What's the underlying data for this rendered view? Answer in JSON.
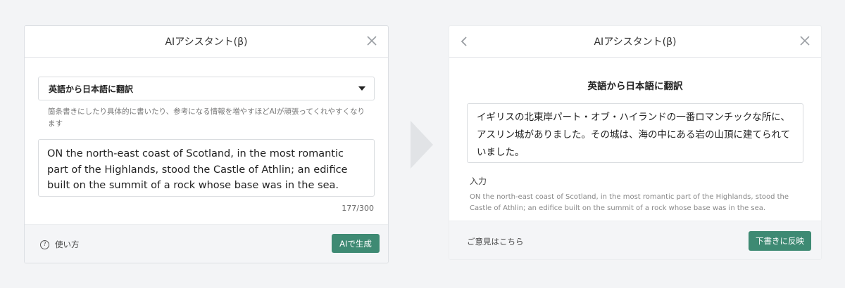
{
  "left_panel": {
    "title": "AIアシスタント(β)",
    "select_value": "英語から日本語に翻訳",
    "hint": "箇条書きにしたり具体的に書いたり、参考になる情報を増やすほどAIが頑張ってくれやすくなります",
    "input_text": "ON the north-east coast of Scotland, in the most romantic part of the Highlands, stood the Castle of Athlin; an edifice built on the summit of a rock whose base was in the sea.",
    "counter": "177/300",
    "help_label": "使い方",
    "help_icon": "?",
    "generate_button": "AIで生成"
  },
  "right_panel": {
    "title": "AIアシスタント(β)",
    "mode_title": "英語から日本語に翻訳",
    "result_text": "イギリスの北東岸パート・オブ・ハイランドの一番ロマンチックな所に、アスリン城がありました。その城は、海の中にある岩の山頂に建てられていました。",
    "input_label": "入力",
    "input_text": "ON the north-east coast of Scotland, in the most romantic part of the Highlands, stood the Castle of Athlin; an edifice built on the summit of a rock whose base was in the sea.",
    "feedback_link": "ご意見はこちら",
    "draft_button": "下書きに反映"
  },
  "colors": {
    "accent": "#3e8a73",
    "background": "#f3f4f6",
    "footer": "#f4f5f7"
  }
}
